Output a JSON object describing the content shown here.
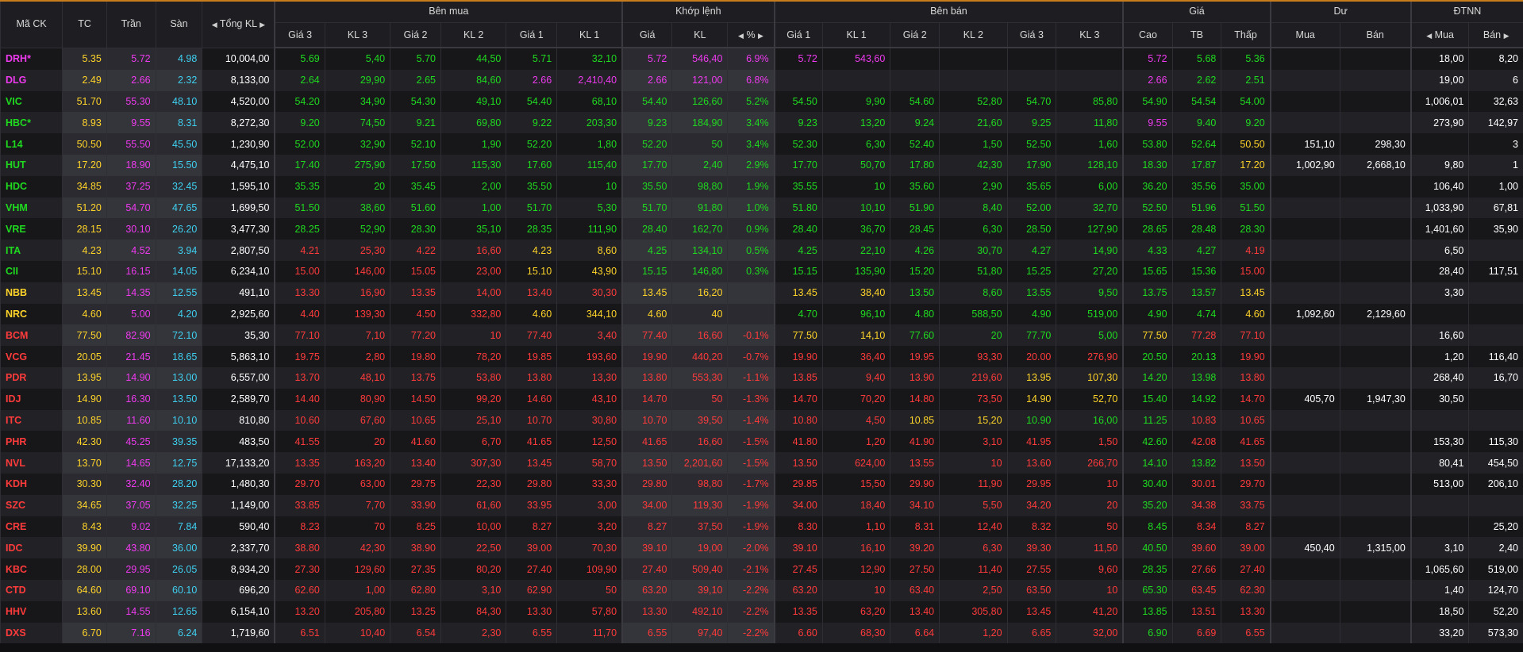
{
  "colors": {
    "up": "#1fda1f",
    "down": "#ff3b3b",
    "ref": "#ffd429",
    "ceiling": "#ee3aee",
    "floor": "#3fd0f0",
    "accent": "#c87c1c"
  },
  "headers": {
    "symbol": "Mã CK",
    "ref": "TC",
    "ceiling": "Trần",
    "floor": "Sàn",
    "total_volume": "Tổng KL",
    "group_bid": "Bên mua",
    "group_matched": "Khớp lệnh",
    "group_ask": "Bên bán",
    "group_price": "Giá",
    "group_remaining": "Dư",
    "group_foreign": "ĐTNN",
    "bid_price3": "Giá 3",
    "bid_vol3": "KL 3",
    "bid_price2": "Giá 2",
    "bid_vol2": "KL 2",
    "bid_price1": "Giá 1",
    "bid_vol1": "KL 1",
    "match_price": "Giá",
    "match_vol": "KL",
    "match_pct": "%",
    "ask_price1": "Giá 1",
    "ask_vol1": "KL 1",
    "ask_price2": "Giá 2",
    "ask_vol2": "KL 2",
    "ask_price3": "Giá 3",
    "ask_vol3": "KL 3",
    "high": "Cao",
    "avg": "TB",
    "low": "Thấp",
    "rem_buy": "Mua",
    "rem_sell": "Bán",
    "foreign_buy": "Mua",
    "foreign_sell": "Bán"
  },
  "rows": [
    {
      "sym": "DRH*",
      "tc": "5.35",
      "ceil": "5.72",
      "floor": "4.98",
      "vol": "10,004,00",
      "b3": "5.69",
      "bv3": "5,40",
      "b2": "5.70",
      "bv2": "44,50",
      "b1": "5.71",
      "bv1": "32,10",
      "mp": "5.72",
      "mv": "546,40",
      "pct": "6.9%",
      "a1": "5.72",
      "av1": "543,60",
      "a2": "",
      "av2": "",
      "a3": "",
      "av3": "",
      "hi": "5.72",
      "avg": "5.68",
      "lo": "5.36",
      "rb": "",
      "rs": "",
      "fb": "18,00",
      "fs": "8,20"
    },
    {
      "sym": "DLG",
      "tc": "2.49",
      "ceil": "2.66",
      "floor": "2.32",
      "vol": "8,133,00",
      "b3": "2.64",
      "bv3": "29,90",
      "b2": "2.65",
      "bv2": "84,60",
      "b1": "2.66",
      "bv1": "2,410,40",
      "mp": "2.66",
      "mv": "121,00",
      "pct": "6.8%",
      "a1": "",
      "av1": "",
      "a2": "",
      "av2": "",
      "a3": "",
      "av3": "",
      "hi": "2.66",
      "avg": "2.62",
      "lo": "2.51",
      "rb": "",
      "rs": "",
      "fb": "19,00",
      "fs": "6"
    },
    {
      "sym": "VIC",
      "tc": "51.70",
      "ceil": "55.30",
      "floor": "48.10",
      "vol": "4,520,00",
      "b3": "54.20",
      "bv3": "34,90",
      "b2": "54.30",
      "bv2": "49,10",
      "b1": "54.40",
      "bv1": "68,10",
      "mp": "54.40",
      "mv": "126,60",
      "pct": "5.2%",
      "a1": "54.50",
      "av1": "9,90",
      "a2": "54.60",
      "av2": "52,80",
      "a3": "54.70",
      "av3": "85,80",
      "hi": "54.90",
      "avg": "54.54",
      "lo": "54.00",
      "rb": "",
      "rs": "",
      "fb": "1,006,01",
      "fs": "32,63"
    },
    {
      "sym": "HBC*",
      "tc": "8.93",
      "ceil": "9.55",
      "floor": "8.31",
      "vol": "8,272,30",
      "b3": "9.20",
      "bv3": "74,50",
      "b2": "9.21",
      "bv2": "69,80",
      "b1": "9.22",
      "bv1": "203,30",
      "mp": "9.23",
      "mv": "184,90",
      "pct": "3.4%",
      "a1": "9.23",
      "av1": "13,20",
      "a2": "9.24",
      "av2": "21,60",
      "a3": "9.25",
      "av3": "11,80",
      "hi": "9.55",
      "avg": "9.40",
      "lo": "9.20",
      "rb": "",
      "rs": "",
      "fb": "273,90",
      "fs": "142,97"
    },
    {
      "sym": "L14",
      "tc": "50.50",
      "ceil": "55.50",
      "floor": "45.50",
      "vol": "1,230,90",
      "b3": "52.00",
      "bv3": "32,90",
      "b2": "52.10",
      "bv2": "1,90",
      "b1": "52.20",
      "bv1": "1,80",
      "mp": "52.20",
      "mv": "50",
      "pct": "3.4%",
      "a1": "52.30",
      "av1": "6,30",
      "a2": "52.40",
      "av2": "1,50",
      "a3": "52.50",
      "av3": "1,60",
      "hi": "53.80",
      "avg": "52.64",
      "lo": "50.50",
      "rb": "151,10",
      "rs": "298,30",
      "fb": "",
      "fs": "3"
    },
    {
      "sym": "HUT",
      "tc": "17.20",
      "ceil": "18.90",
      "floor": "15.50",
      "vol": "4,475,10",
      "b3": "17.40",
      "bv3": "275,90",
      "b2": "17.50",
      "bv2": "115,30",
      "b1": "17.60",
      "bv1": "115,40",
      "mp": "17.70",
      "mv": "2,40",
      "pct": "2.9%",
      "a1": "17.70",
      "av1": "50,70",
      "a2": "17.80",
      "av2": "42,30",
      "a3": "17.90",
      "av3": "128,10",
      "hi": "18.30",
      "avg": "17.87",
      "lo": "17.20",
      "rb": "1,002,90",
      "rs": "2,668,10",
      "fb": "9,80",
      "fs": "1"
    },
    {
      "sym": "HDC",
      "tc": "34.85",
      "ceil": "37.25",
      "floor": "32.45",
      "vol": "1,595,10",
      "b3": "35.35",
      "bv3": "20",
      "b2": "35.45",
      "bv2": "2,00",
      "b1": "35.50",
      "bv1": "10",
      "mp": "35.50",
      "mv": "98,80",
      "pct": "1.9%",
      "a1": "35.55",
      "av1": "10",
      "a2": "35.60",
      "av2": "2,90",
      "a3": "35.65",
      "av3": "6,00",
      "hi": "36.20",
      "avg": "35.56",
      "lo": "35.00",
      "rb": "",
      "rs": "",
      "fb": "106,40",
      "fs": "1,00"
    },
    {
      "sym": "VHM",
      "tc": "51.20",
      "ceil": "54.70",
      "floor": "47.65",
      "vol": "1,699,50",
      "b3": "51.50",
      "bv3": "38,60",
      "b2": "51.60",
      "bv2": "1,00",
      "b1": "51.70",
      "bv1": "5,30",
      "mp": "51.70",
      "mv": "91,80",
      "pct": "1.0%",
      "a1": "51.80",
      "av1": "10,10",
      "a2": "51.90",
      "av2": "8,40",
      "a3": "52.00",
      "av3": "32,70",
      "hi": "52.50",
      "avg": "51.96",
      "lo": "51.50",
      "rb": "",
      "rs": "",
      "fb": "1,033,90",
      "fs": "67,81"
    },
    {
      "sym": "VRE",
      "tc": "28.15",
      "ceil": "30.10",
      "floor": "26.20",
      "vol": "3,477,30",
      "b3": "28.25",
      "bv3": "52,90",
      "b2": "28.30",
      "bv2": "35,10",
      "b1": "28.35",
      "bv1": "111,90",
      "mp": "28.40",
      "mv": "162,70",
      "pct": "0.9%",
      "a1": "28.40",
      "av1": "36,70",
      "a2": "28.45",
      "av2": "6,30",
      "a3": "28.50",
      "av3": "127,90",
      "hi": "28.65",
      "avg": "28.48",
      "lo": "28.30",
      "rb": "",
      "rs": "",
      "fb": "1,401,60",
      "fs": "35,90"
    },
    {
      "sym": "ITA",
      "tc": "4.23",
      "ceil": "4.52",
      "floor": "3.94",
      "vol": "2,807,50",
      "b3": "4.21",
      "bv3": "25,30",
      "b2": "4.22",
      "bv2": "16,60",
      "b1": "4.23",
      "bv1": "8,60",
      "mp": "4.25",
      "mv": "134,10",
      "pct": "0.5%",
      "a1": "4.25",
      "av1": "22,10",
      "a2": "4.26",
      "av2": "30,70",
      "a3": "4.27",
      "av3": "14,90",
      "hi": "4.33",
      "avg": "4.27",
      "lo": "4.19",
      "rb": "",
      "rs": "",
      "fb": "6,50",
      "fs": ""
    },
    {
      "sym": "CII",
      "tc": "15.10",
      "ceil": "16.15",
      "floor": "14.05",
      "vol": "6,234,10",
      "b3": "15.00",
      "bv3": "146,00",
      "b2": "15.05",
      "bv2": "23,00",
      "b1": "15.10",
      "bv1": "43,90",
      "mp": "15.15",
      "mv": "146,80",
      "pct": "0.3%",
      "a1": "15.15",
      "av1": "135,90",
      "a2": "15.20",
      "av2": "51,80",
      "a3": "15.25",
      "av3": "27,20",
      "hi": "15.65",
      "avg": "15.36",
      "lo": "15.00",
      "rb": "",
      "rs": "",
      "fb": "28,40",
      "fs": "117,51"
    },
    {
      "sym": "NBB",
      "tc": "13.45",
      "ceil": "14.35",
      "floor": "12.55",
      "vol": "491,10",
      "b3": "13.30",
      "bv3": "16,90",
      "b2": "13.35",
      "bv2": "14,00",
      "b1": "13.40",
      "bv1": "30,30",
      "mp": "13.45",
      "mv": "16,20",
      "pct": "",
      "a1": "13.45",
      "av1": "38,40",
      "a2": "13.50",
      "av2": "8,60",
      "a3": "13.55",
      "av3": "9,50",
      "hi": "13.75",
      "avg": "13.57",
      "lo": "13.45",
      "rb": "",
      "rs": "",
      "fb": "3,30",
      "fs": ""
    },
    {
      "sym": "NRC",
      "tc": "4.60",
      "ceil": "5.00",
      "floor": "4.20",
      "vol": "2,925,60",
      "b3": "4.40",
      "bv3": "139,30",
      "b2": "4.50",
      "bv2": "332,80",
      "b1": "4.60",
      "bv1": "344,10",
      "mp": "4.60",
      "mv": "40",
      "pct": "",
      "a1": "4.70",
      "av1": "96,10",
      "a2": "4.80",
      "av2": "588,50",
      "a3": "4.90",
      "av3": "519,00",
      "hi": "4.90",
      "avg": "4.74",
      "lo": "4.60",
      "rb": "1,092,60",
      "rs": "2,129,60",
      "fb": "",
      "fs": ""
    },
    {
      "sym": "BCM",
      "tc": "77.50",
      "ceil": "82.90",
      "floor": "72.10",
      "vol": "35,30",
      "b3": "77.10",
      "bv3": "7,10",
      "b2": "77.20",
      "bv2": "10",
      "b1": "77.40",
      "bv1": "3,40",
      "mp": "77.40",
      "mv": "16,60",
      "pct": "-0.1%",
      "a1": "77.50",
      "av1": "14,10",
      "a2": "77.60",
      "av2": "20",
      "a3": "77.70",
      "av3": "5,00",
      "hi": "77.50",
      "avg": "77.28",
      "lo": "77.10",
      "rb": "",
      "rs": "",
      "fb": "16,60",
      "fs": ""
    },
    {
      "sym": "VCG",
      "tc": "20.05",
      "ceil": "21.45",
      "floor": "18.65",
      "vol": "5,863,10",
      "b3": "19.75",
      "bv3": "2,80",
      "b2": "19.80",
      "bv2": "78,20",
      "b1": "19.85",
      "bv1": "193,60",
      "mp": "19.90",
      "mv": "440,20",
      "pct": "-0.7%",
      "a1": "19.90",
      "av1": "36,40",
      "a2": "19.95",
      "av2": "93,30",
      "a3": "20.00",
      "av3": "276,90",
      "hi": "20.50",
      "avg": "20.13",
      "lo": "19.90",
      "rb": "",
      "rs": "",
      "fb": "1,20",
      "fs": "116,40"
    },
    {
      "sym": "PDR",
      "tc": "13.95",
      "ceil": "14.90",
      "floor": "13.00",
      "vol": "6,557,00",
      "b3": "13.70",
      "bv3": "48,10",
      "b2": "13.75",
      "bv2": "53,80",
      "b1": "13.80",
      "bv1": "13,30",
      "mp": "13.80",
      "mv": "553,30",
      "pct": "-1.1%",
      "a1": "13.85",
      "av1": "9,40",
      "a2": "13.90",
      "av2": "219,60",
      "a3": "13.95",
      "av3": "107,30",
      "hi": "14.20",
      "avg": "13.98",
      "lo": "13.80",
      "rb": "",
      "rs": "",
      "fb": "268,40",
      "fs": "16,70"
    },
    {
      "sym": "IDJ",
      "tc": "14.90",
      "ceil": "16.30",
      "floor": "13.50",
      "vol": "2,589,70",
      "b3": "14.40",
      "bv3": "80,90",
      "b2": "14.50",
      "bv2": "99,20",
      "b1": "14.60",
      "bv1": "43,10",
      "mp": "14.70",
      "mv": "50",
      "pct": "-1.3%",
      "a1": "14.70",
      "av1": "70,20",
      "a2": "14.80",
      "av2": "73,50",
      "a3": "14.90",
      "av3": "52,70",
      "hi": "15.40",
      "avg": "14.92",
      "lo": "14.70",
      "rb": "405,70",
      "rs": "1,947,30",
      "fb": "30,50",
      "fs": ""
    },
    {
      "sym": "ITC",
      "tc": "10.85",
      "ceil": "11.60",
      "floor": "10.10",
      "vol": "810,80",
      "b3": "10.60",
      "bv3": "67,60",
      "b2": "10.65",
      "bv2": "25,10",
      "b1": "10.70",
      "bv1": "30,80",
      "mp": "10.70",
      "mv": "39,50",
      "pct": "-1.4%",
      "a1": "10.80",
      "av1": "4,50",
      "a2": "10.85",
      "av2": "15,20",
      "a3": "10.90",
      "av3": "16,00",
      "hi": "11.25",
      "avg": "10.83",
      "lo": "10.65",
      "rb": "",
      "rs": "",
      "fb": "",
      "fs": ""
    },
    {
      "sym": "PHR",
      "tc": "42.30",
      "ceil": "45.25",
      "floor": "39.35",
      "vol": "483,50",
      "b3": "41.55",
      "bv3": "20",
      "b2": "41.60",
      "bv2": "6,70",
      "b1": "41.65",
      "bv1": "12,50",
      "mp": "41.65",
      "mv": "16,60",
      "pct": "-1.5%",
      "a1": "41.80",
      "av1": "1,20",
      "a2": "41.90",
      "av2": "3,10",
      "a3": "41.95",
      "av3": "1,50",
      "hi": "42.60",
      "avg": "42.08",
      "lo": "41.65",
      "rb": "",
      "rs": "",
      "fb": "153,30",
      "fs": "115,30"
    },
    {
      "sym": "NVL",
      "tc": "13.70",
      "ceil": "14.65",
      "floor": "12.75",
      "vol": "17,133,20",
      "b3": "13.35",
      "bv3": "163,20",
      "b2": "13.40",
      "bv2": "307,30",
      "b1": "13.45",
      "bv1": "58,70",
      "mp": "13.50",
      "mv": "2,201,60",
      "pct": "-1.5%",
      "a1": "13.50",
      "av1": "624,00",
      "a2": "13.55",
      "av2": "10",
      "a3": "13.60",
      "av3": "266,70",
      "hi": "14.10",
      "avg": "13.82",
      "lo": "13.50",
      "rb": "",
      "rs": "",
      "fb": "80,41",
      "fs": "454,50"
    },
    {
      "sym": "KDH",
      "tc": "30.30",
      "ceil": "32.40",
      "floor": "28.20",
      "vol": "1,480,30",
      "b3": "29.70",
      "bv3": "63,00",
      "b2": "29.75",
      "bv2": "22,30",
      "b1": "29.80",
      "bv1": "33,30",
      "mp": "29.80",
      "mv": "98,80",
      "pct": "-1.7%",
      "a1": "29.85",
      "av1": "15,50",
      "a2": "29.90",
      "av2": "11,90",
      "a3": "29.95",
      "av3": "10",
      "hi": "30.40",
      "avg": "30.01",
      "lo": "29.70",
      "rb": "",
      "rs": "",
      "fb": "513,00",
      "fs": "206,10"
    },
    {
      "sym": "SZC",
      "tc": "34.65",
      "ceil": "37.05",
      "floor": "32.25",
      "vol": "1,149,00",
      "b3": "33.85",
      "bv3": "7,70",
      "b2": "33.90",
      "bv2": "61,60",
      "b1": "33.95",
      "bv1": "3,00",
      "mp": "34.00",
      "mv": "119,30",
      "pct": "-1.9%",
      "a1": "34.00",
      "av1": "18,40",
      "a2": "34.10",
      "av2": "5,50",
      "a3": "34.20",
      "av3": "20",
      "hi": "35.20",
      "avg": "34.38",
      "lo": "33.75",
      "rb": "",
      "rs": "",
      "fb": "",
      "fs": ""
    },
    {
      "sym": "CRE",
      "tc": "8.43",
      "ceil": "9.02",
      "floor": "7.84",
      "vol": "590,40",
      "b3": "8.23",
      "bv3": "70",
      "b2": "8.25",
      "bv2": "10,00",
      "b1": "8.27",
      "bv1": "3,20",
      "mp": "8.27",
      "mv": "37,50",
      "pct": "-1.9%",
      "a1": "8.30",
      "av1": "1,10",
      "a2": "8.31",
      "av2": "12,40",
      "a3": "8.32",
      "av3": "50",
      "hi": "8.45",
      "avg": "8.34",
      "lo": "8.27",
      "rb": "",
      "rs": "",
      "fb": "",
      "fs": "25,20"
    },
    {
      "sym": "IDC",
      "tc": "39.90",
      "ceil": "43.80",
      "floor": "36.00",
      "vol": "2,337,70",
      "b3": "38.80",
      "bv3": "42,30",
      "b2": "38.90",
      "bv2": "22,50",
      "b1": "39.00",
      "bv1": "70,30",
      "mp": "39.10",
      "mv": "19,00",
      "pct": "-2.0%",
      "a1": "39.10",
      "av1": "16,10",
      "a2": "39.20",
      "av2": "6,30",
      "a3": "39.30",
      "av3": "11,50",
      "hi": "40.50",
      "avg": "39.60",
      "lo": "39.00",
      "rb": "450,40",
      "rs": "1,315,00",
      "fb": "3,10",
      "fs": "2,40"
    },
    {
      "sym": "KBC",
      "tc": "28.00",
      "ceil": "29.95",
      "floor": "26.05",
      "vol": "8,934,20",
      "b3": "27.30",
      "bv3": "129,60",
      "b2": "27.35",
      "bv2": "80,20",
      "b1": "27.40",
      "bv1": "109,90",
      "mp": "27.40",
      "mv": "509,40",
      "pct": "-2.1%",
      "a1": "27.45",
      "av1": "12,90",
      "a2": "27.50",
      "av2": "11,40",
      "a3": "27.55",
      "av3": "9,60",
      "hi": "28.35",
      "avg": "27.66",
      "lo": "27.40",
      "rb": "",
      "rs": "",
      "fb": "1,065,60",
      "fs": "519,00"
    },
    {
      "sym": "CTD",
      "tc": "64.60",
      "ceil": "69.10",
      "floor": "60.10",
      "vol": "696,20",
      "b3": "62.60",
      "bv3": "1,00",
      "b2": "62.80",
      "bv2": "3,10",
      "b1": "62.90",
      "bv1": "50",
      "mp": "63.20",
      "mv": "39,10",
      "pct": "-2.2%",
      "a1": "63.20",
      "av1": "10",
      "a2": "63.40",
      "av2": "2,50",
      "a3": "63.50",
      "av3": "10",
      "hi": "65.30",
      "avg": "63.45",
      "lo": "62.30",
      "rb": "",
      "rs": "",
      "fb": "1,40",
      "fs": "124,70"
    },
    {
      "sym": "HHV",
      "tc": "13.60",
      "ceil": "14.55",
      "floor": "12.65",
      "vol": "6,154,10",
      "b3": "13.20",
      "bv3": "205,80",
      "b2": "13.25",
      "bv2": "84,30",
      "b1": "13.30",
      "bv1": "57,80",
      "mp": "13.30",
      "mv": "492,10",
      "pct": "-2.2%",
      "a1": "13.35",
      "av1": "63,20",
      "a2": "13.40",
      "av2": "305,80",
      "a3": "13.45",
      "av3": "41,20",
      "hi": "13.85",
      "avg": "13.51",
      "lo": "13.30",
      "rb": "",
      "rs": "",
      "fb": "18,50",
      "fs": "52,20"
    },
    {
      "sym": "DXS",
      "tc": "6.70",
      "ceil": "7.16",
      "floor": "6.24",
      "vol": "1,719,60",
      "b3": "6.51",
      "bv3": "10,40",
      "b2": "6.54",
      "bv2": "2,30",
      "b1": "6.55",
      "bv1": "11,70",
      "mp": "6.55",
      "mv": "97,40",
      "pct": "-2.2%",
      "a1": "6.60",
      "av1": "68,30",
      "a2": "6.64",
      "av2": "1,20",
      "a3": "6.65",
      "av3": "32,00",
      "hi": "6.90",
      "avg": "6.69",
      "lo": "6.55",
      "rb": "",
      "rs": "",
      "fb": "33,20",
      "fs": "573,30"
    }
  ]
}
